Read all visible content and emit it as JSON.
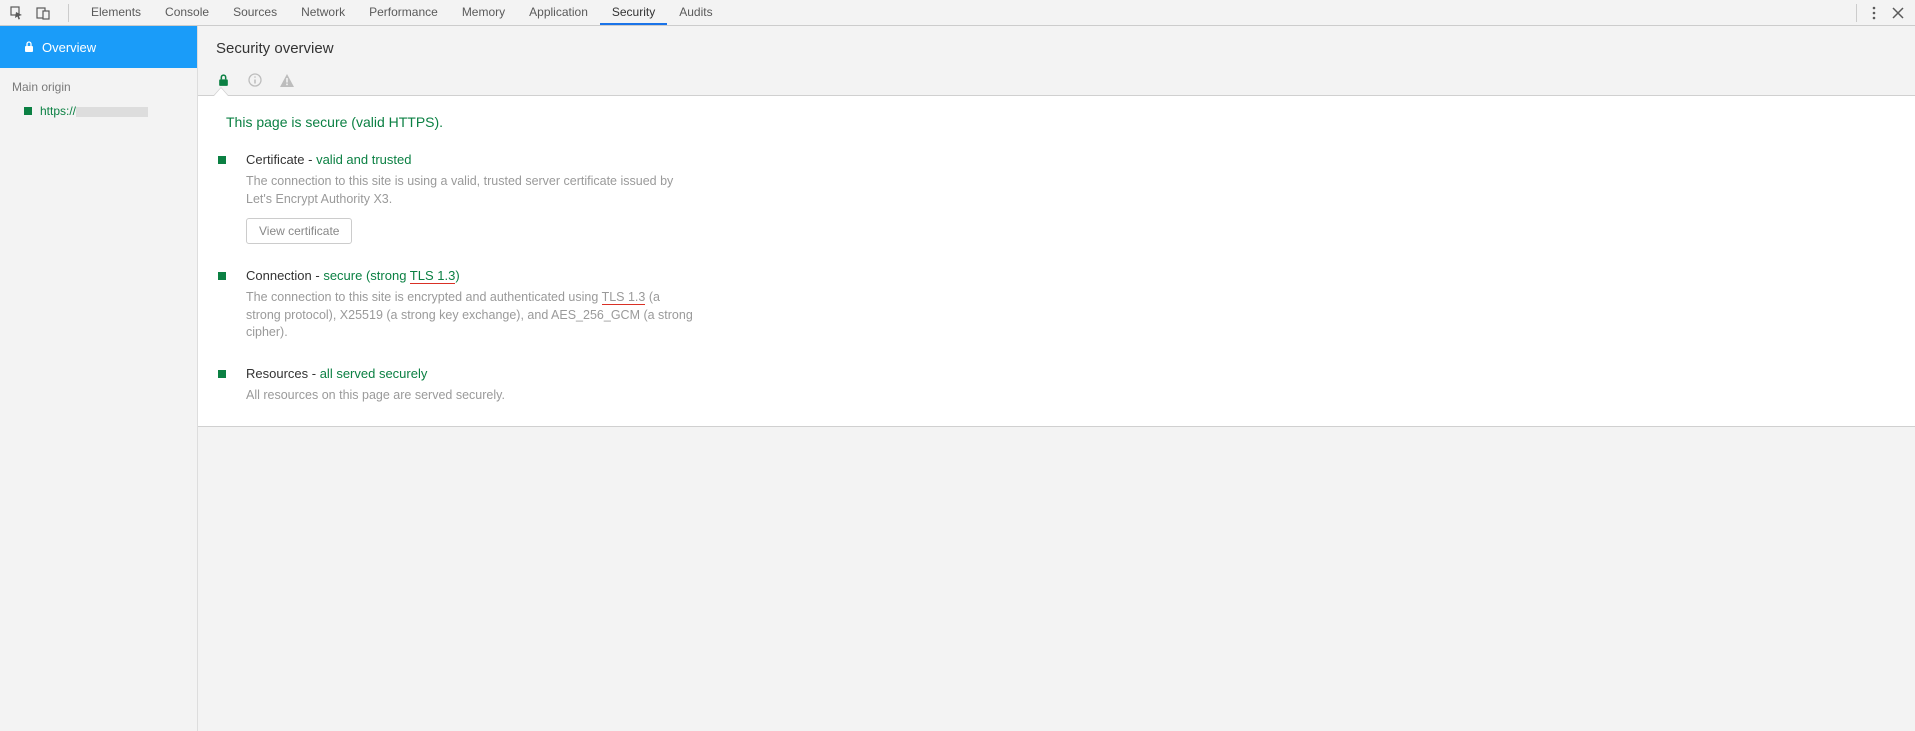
{
  "tabs": [
    "Elements",
    "Console",
    "Sources",
    "Network",
    "Performance",
    "Memory",
    "Application",
    "Security",
    "Audits"
  ],
  "active_tab": "Security",
  "sidebar": {
    "overview_label": "Overview",
    "section_title": "Main origin",
    "origin_prefix": "https://"
  },
  "header": {
    "title": "Security overview"
  },
  "secure_msg": "This page is secure (valid HTTPS).",
  "certificate": {
    "key": "Certificate - ",
    "val": "valid and trusted",
    "desc": "The connection to this site is using a valid, trusted server certificate issued by Let's Encrypt Authority X3.",
    "button": "View certificate"
  },
  "connection": {
    "key": "Connection - ",
    "val_prefix": "secure (strong ",
    "val_tls": "TLS 1.3",
    "val_suffix": ")",
    "desc_prefix": "The connection to this site is encrypted and authenticated using ",
    "desc_tls": "TLS 1.3",
    "desc_suffix": " (a strong protocol), X25519 (a strong key exchange), and AES_256_GCM (a strong cipher)."
  },
  "resources": {
    "key": "Resources - ",
    "val": "all served securely",
    "desc": "All resources on this page are served securely."
  }
}
